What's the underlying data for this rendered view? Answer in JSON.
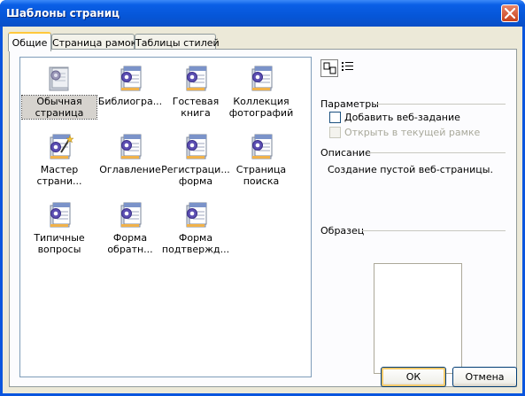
{
  "window": {
    "title": "Шаблоны страниц"
  },
  "tabs": [
    {
      "label": "Общие",
      "active": true
    },
    {
      "label": "Страница рамок",
      "active": false
    },
    {
      "label": "Таблицы стилей",
      "active": false
    }
  ],
  "templates": [
    {
      "label": "Обычная страница",
      "icon": "blank-page-icon",
      "selected": true
    },
    {
      "label": "Библиогра...",
      "icon": "template-page-icon"
    },
    {
      "label": "Гостевая книга",
      "icon": "template-page-icon"
    },
    {
      "label": "Коллекция фотографий",
      "icon": "template-page-icon"
    },
    {
      "label": "Мастер страни...",
      "icon": "wizard-page-icon"
    },
    {
      "label": "Оглавление",
      "icon": "template-page-icon"
    },
    {
      "label": "Регистраци... форма",
      "icon": "template-page-icon"
    },
    {
      "label": "Страница поиска",
      "icon": "template-page-icon"
    },
    {
      "label": "Типичные вопросы",
      "icon": "template-page-icon"
    },
    {
      "label": "Форма обратн...",
      "icon": "template-page-icon"
    },
    {
      "label": "Форма подтвержд...",
      "icon": "template-page-icon"
    }
  ],
  "view_buttons": [
    {
      "name": "large-icons-view-icon",
      "active": true
    },
    {
      "name": "details-view-icon",
      "active": false
    }
  ],
  "options": {
    "section_label": "Параметры",
    "add_web_task": {
      "label": "Добавить веб-задание",
      "checked": false,
      "enabled": true
    },
    "open_in_frame": {
      "label": "Открыть в текущей рамке",
      "checked": false,
      "enabled": false
    }
  },
  "description": {
    "section_label": "Описание",
    "text": "Создание пустой веб-страницы."
  },
  "preview": {
    "section_label": "Образец"
  },
  "buttons": {
    "ok": "ОК",
    "cancel": "Отмена"
  }
}
